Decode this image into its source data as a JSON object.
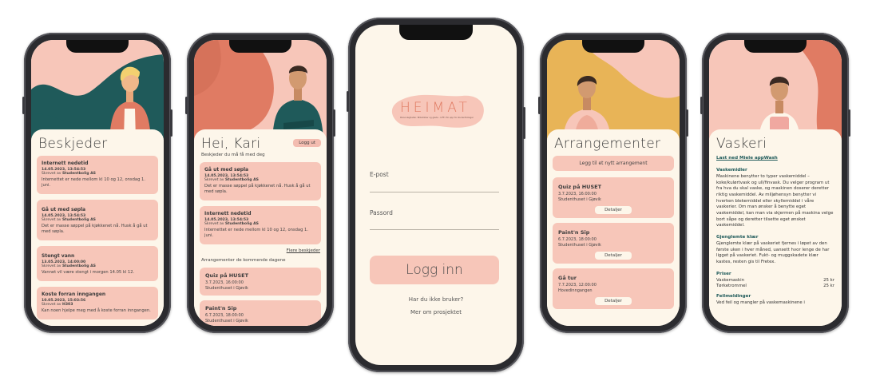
{
  "colors": {
    "cream": "#fdf6ea",
    "pink": "#f7c6b9",
    "teal": "#1f5a5a",
    "salmon": "#e07b63",
    "mustard": "#e8b457"
  },
  "messages": {
    "title": "Beskjeder",
    "items": [
      {
        "title": "Internett nedetid",
        "date": "14.05.2023, 13:54:53",
        "by_prefix": "Skrevet av",
        "by": "Studentbolig AS",
        "text": "Internettet er nede mellom kl 10 og 12, onsdag 1. juni."
      },
      {
        "title": "Gå ut med søpla",
        "date": "14.05.2023, 13:54:53",
        "by_prefix": "Skrevet av",
        "by": "Studentbolig AS",
        "text": "Det er masse søppel på kjøkkenet nå. Husk å gå ut med søpla."
      },
      {
        "title": "Stengt vann",
        "date": "13.05.2023, 14:00:00",
        "by_prefix": "Skrevet av",
        "by": "Studentbolig AS",
        "text": "Vannet vil være stengt i morgen 14.05 kl 12."
      },
      {
        "title": "Koste forran inngangen",
        "date": "10.05.2023, 15:03:56",
        "by_prefix": "Skrevet av",
        "by": "H303",
        "text": "Kan noen hjelpe meg med å koste forran inngangen."
      }
    ]
  },
  "home": {
    "greeting": "Hei, Kari",
    "logout_label": "Logg ut",
    "subtitle": "Beskjeder du må få med deg",
    "items": [
      {
        "title": "Gå ut med søpla",
        "date": "14.05.2023, 13:54:53",
        "by_prefix": "Skrevet av",
        "by": "Studentbolig AS",
        "text": "Det er masse søppel på kjøkkenet nå. Husk å gå ut med søpla."
      },
      {
        "title": "Internett nedetid",
        "date": "14.05.2023, 13:54:53",
        "by_prefix": "Skrevet av",
        "by": "Studentbolig AS",
        "text": "Internettet er nede mellom kl 10 og 12, onsdag 1. juni."
      }
    ],
    "more_link": "Flere beskjeder",
    "events_heading": "Arrangementer de kommende dagene",
    "events": [
      {
        "title": "Quiz på HUSET",
        "date": "3.7.2023, 16:00:00",
        "place": "Studenthuset i Gjøvik"
      },
      {
        "title": "Paint'n Sip",
        "date": "6.7.2023, 18:00:00",
        "place": "Studenthuset i Gjøvik"
      }
    ]
  },
  "login": {
    "logo_text": "HEIMAT",
    "logo_tagline": "Personlegheiter. Bilbutikkar og glede - LIFE. Ein app for studentbolagar",
    "email_label": "E-post",
    "password_label": "Passord",
    "login_button": "Logg inn",
    "no_user": "Har du ikke bruker?",
    "about": "Mer om prosjektet"
  },
  "events": {
    "title": "Arrangementer",
    "add_button": "Legg til et nytt arrangement",
    "details_label": "Detaljer",
    "items": [
      {
        "title": "Quiz på HUSET",
        "date": "3.7.2023, 16:00:00",
        "place": "Studenthuset i Gjøvik"
      },
      {
        "title": "Paint'n Sip",
        "date": "6.7.2023, 18:00:00",
        "place": "Studenthuset i Gjøvik"
      },
      {
        "title": "Gå tur",
        "date": "7.7.2023, 12:00:00",
        "place": "Hovedinngangen"
      }
    ]
  },
  "laundry": {
    "title": "Vaskeri",
    "app_link": "Last ned Miele appWash",
    "sections": [
      {
        "heading": "Vaskemidler",
        "text": "Maskinene benytter to typer vaskemiddel – koke/kulørtvask og ull/finvask. Du velger program ut fra hva du skal vaske, og maskinen doserer deretter riktig vaskemiddel. Av miljøhensyn benytter vi hverken blekemiddel eller skyllemiddel i våre vaskerier. Om man ønsker å benytte eget vaskemiddel, kan man via skjermen på maskina velge bort såpe og deretter tilsette eget ønsket vaskemiddel."
      },
      {
        "heading": "Gjenglemte klær",
        "text": "Gjenglemte klær på vaskeriet fjernes i løpet av den første uken i hver måned, uansett hvor lenge de har ligget på vaskeriet. Fukt- og muggskadete klær kastes, resten gis til Fretex."
      }
    ],
    "prices_heading": "Priser",
    "prices": [
      {
        "label": "Vaskemaskin",
        "value": "25 kr"
      },
      {
        "label": "Tørketrommel",
        "value": "25 kr"
      }
    ],
    "faults_heading": "Feilmeldinger",
    "faults_text": "Ved feil og mangler på vaskemaskinene i"
  }
}
